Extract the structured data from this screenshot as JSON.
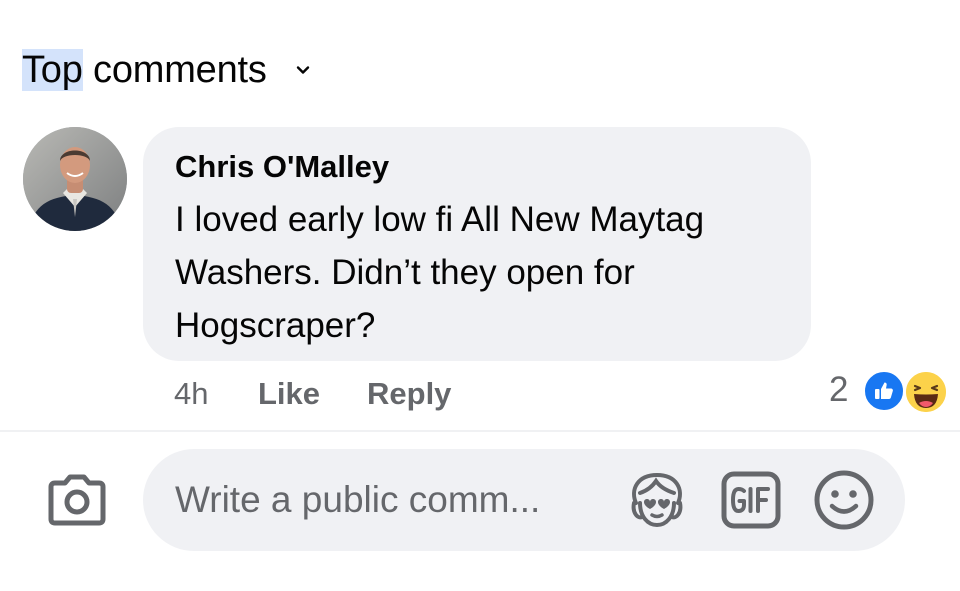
{
  "sort": {
    "label_highlight": "Top",
    "label_rest": " comments",
    "icon": "chevron-down-icon"
  },
  "comment": {
    "author": "Chris O'Malley",
    "text": "I loved early low fi All New Maytag Washers.  Didn’t they open for Hogscraper?",
    "time": "4h",
    "like_label": "Like",
    "reply_label": "Reply",
    "reaction_count": "2",
    "reactions": [
      "like-reaction-icon",
      "haha-reaction-icon"
    ]
  },
  "composer": {
    "placeholder": "Write a public comm...",
    "icons": [
      "camera-icon",
      "avatar-sticker-icon",
      "gif-icon",
      "emoji-icon"
    ]
  },
  "colors": {
    "bubble": "#f0f1f4",
    "secondary_text": "#65676b",
    "like_blue": "#1877f2",
    "haha_yellow": "#fcd24a",
    "highlight": "#d4e3fb"
  }
}
